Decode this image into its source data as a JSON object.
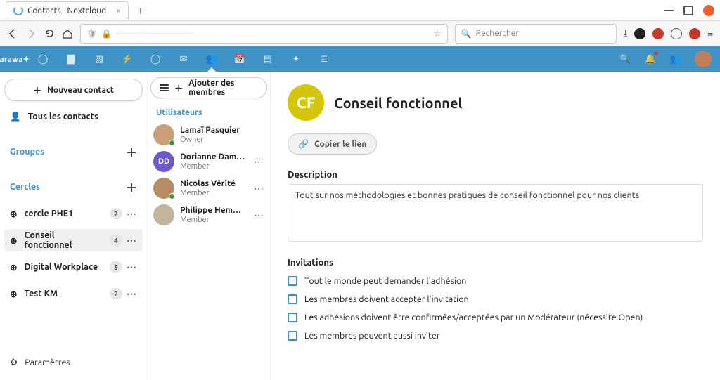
{
  "browser": {
    "tab_title": "Contacts - Nextcloud",
    "search_placeholder": "Rechercher"
  },
  "sidebar": {
    "new_contact": "Nouveau contact",
    "all_contacts": "Tous les contacts",
    "groups_label": "Groupes",
    "circles_label": "Cercles",
    "circles": [
      {
        "name": "cercle PHE1",
        "count": "2"
      },
      {
        "name": "Conseil fonctionnel",
        "count": "4"
      },
      {
        "name": "Digital Workplace",
        "count": "5"
      },
      {
        "name": "Test KM",
        "count": "2"
      }
    ],
    "settings": "Paramètres"
  },
  "members": {
    "add_label": "Ajouter des membres",
    "section": "Utilisateurs",
    "list": [
      {
        "name": "Lamaï Pasquier",
        "role": "Owner",
        "initials": "",
        "color": "#c9a07a"
      },
      {
        "name": "Dorianne Dam…",
        "role": "Member",
        "initials": "DD",
        "color": "#6a5acd"
      },
      {
        "name": "Nicolas Vérité",
        "role": "Member",
        "initials": "",
        "color": "#b78d64"
      },
      {
        "name": "Philippe Hem…",
        "role": "Member",
        "initials": "",
        "color": "#c3b59b"
      }
    ]
  },
  "detail": {
    "initials": "CF",
    "title": "Conseil fonctionnel",
    "copy_link": "Copier le lien",
    "desc_label": "Description",
    "description": "Tout sur nos méthodologies et bonnes pratiques de conseil fonctionnel pour nos clients",
    "inv_label": "Invitations",
    "invitations": [
      "Tout le monde peut demander l'adhésion",
      "Les membres doivent accepter l'invitation",
      "Les adhésions doivent être confirmées/acceptées par un Modérateur (nécessite Open)",
      "Les membres peuvent aussi inviter"
    ]
  }
}
